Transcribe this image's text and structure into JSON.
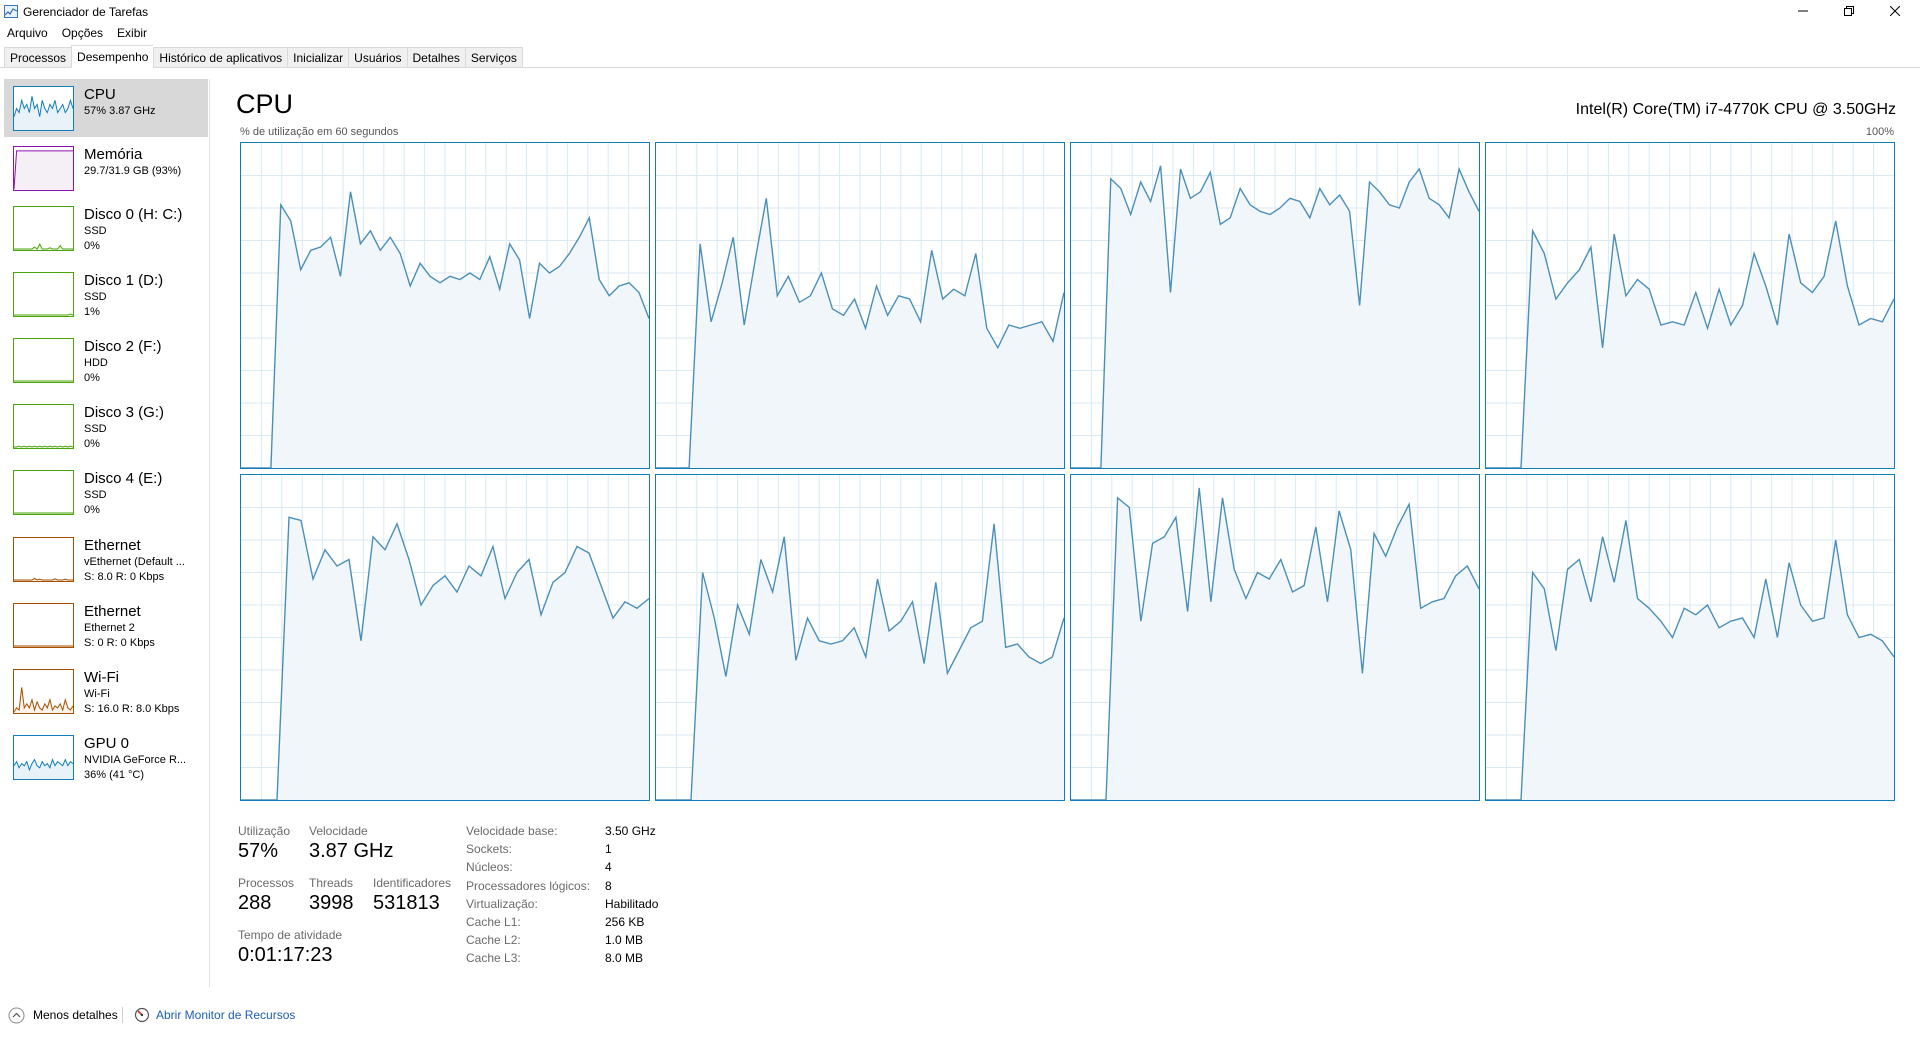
{
  "window": {
    "title": "Gerenciador de Tarefas"
  },
  "menu": [
    "Arquivo",
    "Opções",
    "Exibir"
  ],
  "tabs": [
    {
      "label": "Processos",
      "active": false
    },
    {
      "label": "Desempenho",
      "active": true
    },
    {
      "label": "Histórico de aplicativos",
      "active": false
    },
    {
      "label": "Inicializar",
      "active": false
    },
    {
      "label": "Usuários",
      "active": false
    },
    {
      "label": "Detalhes",
      "active": false
    },
    {
      "label": "Serviços",
      "active": false
    }
  ],
  "sidebar": {
    "items": [
      {
        "name": "CPU",
        "line1": "57%  3.87 GHz",
        "line2": "",
        "color": "#117dbb",
        "fill": "#e9f2f9",
        "selected": true,
        "history": [
          0.3,
          0.5,
          0.4,
          0.7,
          0.5,
          0.6,
          0.4,
          0.8,
          0.5,
          0.6,
          0.3,
          0.7,
          0.5,
          0.4,
          0.6,
          0.5,
          0.7,
          0.4,
          0.5,
          0.6,
          0.4,
          0.5,
          0.7,
          0.5
        ]
      },
      {
        "name": "Memória",
        "line1": "29.7/31.9 GB (93%)",
        "line2": "",
        "color": "#8b12ae",
        "fill": "#f4f0f6",
        "selected": false,
        "history": [
          0.0,
          0.93,
          0.93,
          0.93,
          0.93,
          0.93,
          0.93,
          0.93,
          0.93,
          0.93,
          0.93,
          0.93,
          0.93,
          0.93,
          0.93,
          0.93,
          0.93,
          0.93,
          0.93,
          0.93,
          0.93,
          0.93,
          0.93,
          0.93
        ]
      },
      {
        "name": "Disco 0 (H: C:)",
        "line1": "SSD",
        "line2": "0%",
        "color": "#4da60c",
        "fill": "#eff7ea",
        "selected": false,
        "history": [
          0,
          0,
          0,
          0,
          0,
          0,
          0,
          0,
          0.05,
          0,
          0.12,
          0,
          0,
          0,
          0.03,
          0,
          0,
          0,
          0.08,
          0,
          0,
          0,
          0,
          0
        ]
      },
      {
        "name": "Disco 1 (D:)",
        "line1": "SSD",
        "line2": "1%",
        "color": "#4da60c",
        "fill": "#eff7ea",
        "selected": false,
        "history": [
          0,
          0,
          0,
          0,
          0,
          0,
          0,
          0,
          0,
          0,
          0,
          0,
          0,
          0,
          0,
          0,
          0,
          0,
          0,
          0,
          0,
          0,
          0.02,
          0
        ]
      },
      {
        "name": "Disco 2 (F:)",
        "line1": "HDD",
        "line2": "0%",
        "color": "#4da60c",
        "fill": "#eff7ea",
        "selected": false,
        "history": [
          0,
          0,
          0,
          0,
          0,
          0,
          0,
          0,
          0,
          0,
          0,
          0,
          0,
          0,
          0,
          0,
          0,
          0,
          0,
          0,
          0,
          0,
          0,
          0
        ]
      },
      {
        "name": "Disco 3 (G:)",
        "line1": "SSD",
        "line2": "0%",
        "color": "#4da60c",
        "fill": "#eff7ea",
        "selected": false,
        "history": [
          0,
          0,
          0.02,
          0,
          0.02,
          0,
          0.02,
          0,
          0.02,
          0,
          0.02,
          0,
          0.02,
          0,
          0.02,
          0,
          0.02,
          0,
          0.02,
          0,
          0.02,
          0,
          0.02,
          0
        ]
      },
      {
        "name": "Disco 4 (E:)",
        "line1": "SSD",
        "line2": "0%",
        "color": "#4da60c",
        "fill": "#eff7ea",
        "selected": false,
        "history": [
          0,
          0,
          0,
          0,
          0,
          0,
          0,
          0,
          0,
          0,
          0,
          0,
          0,
          0,
          0,
          0,
          0,
          0,
          0,
          0,
          0,
          0,
          0,
          0
        ]
      },
      {
        "name": "Ethernet",
        "line1": "vEthernet (Default ...",
        "line2": "S: 8.0  R: 0 Kbps",
        "color": "#a74f01",
        "fill": "#fcf3eb",
        "selected": false,
        "history": [
          0,
          0,
          0,
          0,
          0,
          0,
          0,
          0,
          0.04,
          0,
          0.02,
          0,
          0,
          0,
          0,
          0,
          0.03,
          0,
          0,
          0,
          0.02,
          0,
          0,
          0
        ]
      },
      {
        "name": "Ethernet",
        "line1": "Ethernet 2",
        "line2": "S: 0  R: 0 Kbps",
        "color": "#a74f01",
        "fill": "#fcf3eb",
        "selected": false,
        "history": [
          0,
          0,
          0,
          0,
          0,
          0,
          0,
          0,
          0,
          0,
          0,
          0,
          0,
          0,
          0,
          0,
          0,
          0,
          0,
          0,
          0,
          0,
          0,
          0
        ]
      },
      {
        "name": "Wi-Fi",
        "line1": "Wi-Fi",
        "line2": "S: 16.0  R: 8.0 Kbps",
        "color": "#a74f01",
        "fill": "#fcf3eb",
        "selected": false,
        "history": [
          0,
          0.1,
          0.05,
          0.6,
          0.1,
          0.2,
          0.1,
          0.3,
          0.05,
          0.25,
          0.1,
          0.05,
          0.2,
          0.1,
          0.3,
          0.05,
          0.15,
          0.1,
          0.2,
          0.05,
          0.3,
          0.1,
          0.05,
          0.15
        ]
      },
      {
        "name": "GPU 0",
        "line1": "NVIDIA GeForce R...",
        "line2": "36% (41 °C)",
        "color": "#117dbb",
        "fill": "#e9f2f9",
        "selected": false,
        "history": [
          0.3,
          0.4,
          0.25,
          0.35,
          0.3,
          0.4,
          0.2,
          0.35,
          0.45,
          0.3,
          0.25,
          0.4,
          0.3,
          0.35,
          0.25,
          0.45,
          0.3,
          0.4,
          0.35,
          0.3,
          0.45,
          0.3,
          0.4,
          0.35
        ]
      }
    ]
  },
  "main": {
    "title": "CPU",
    "model": "Intel(R) Core(TM) i7-4770K CPU @ 3.50GHz",
    "graph_caption": "% de utilização em 60 segundos",
    "graph_max": "100%",
    "line_color": "#4b8fb8",
    "fill_color": "#f1f6fa",
    "grid_color": "#d9eaf4",
    "cores": [
      [
        0.0,
        0.0,
        0.0,
        0.0,
        0.81,
        0.76,
        0.61,
        0.67,
        0.68,
        0.71,
        0.59,
        0.85,
        0.69,
        0.73,
        0.67,
        0.71,
        0.66,
        0.56,
        0.63,
        0.59,
        0.57,
        0.59,
        0.58,
        0.6,
        0.58,
        0.65,
        0.55,
        0.69,
        0.64,
        0.46,
        0.63,
        0.6,
        0.62,
        0.66,
        0.71,
        0.77,
        0.58,
        0.53,
        0.56,
        0.57,
        0.54,
        0.46
      ],
      [
        0.0,
        0.0,
        0.0,
        0.0,
        0.69,
        0.45,
        0.57,
        0.71,
        0.44,
        0.64,
        0.83,
        0.53,
        0.59,
        0.51,
        0.53,
        0.6,
        0.49,
        0.47,
        0.52,
        0.43,
        0.56,
        0.47,
        0.53,
        0.52,
        0.45,
        0.67,
        0.52,
        0.55,
        0.53,
        0.66,
        0.43,
        0.37,
        0.44,
        0.43,
        0.44,
        0.45,
        0.39,
        0.54
      ],
      [
        0.0,
        0.0,
        0.0,
        0.0,
        0.89,
        0.86,
        0.78,
        0.88,
        0.82,
        0.93,
        0.54,
        0.92,
        0.83,
        0.85,
        0.91,
        0.75,
        0.77,
        0.86,
        0.81,
        0.79,
        0.78,
        0.8,
        0.83,
        0.82,
        0.77,
        0.86,
        0.81,
        0.84,
        0.79,
        0.5,
        0.88,
        0.85,
        0.81,
        0.8,
        0.88,
        0.92,
        0.83,
        0.81,
        0.77,
        0.92,
        0.85,
        0.79
      ],
      [
        0.0,
        0.0,
        0.0,
        0.0,
        0.73,
        0.66,
        0.52,
        0.57,
        0.61,
        0.68,
        0.37,
        0.72,
        0.53,
        0.58,
        0.55,
        0.44,
        0.45,
        0.44,
        0.54,
        0.43,
        0.55,
        0.44,
        0.5,
        0.66,
        0.56,
        0.44,
        0.72,
        0.57,
        0.54,
        0.59,
        0.76,
        0.56,
        0.44,
        0.46,
        0.45,
        0.52
      ],
      [
        0.0,
        0.0,
        0.0,
        0.0,
        0.87,
        0.86,
        0.68,
        0.77,
        0.72,
        0.74,
        0.49,
        0.81,
        0.77,
        0.85,
        0.74,
        0.6,
        0.66,
        0.69,
        0.64,
        0.72,
        0.69,
        0.78,
        0.62,
        0.7,
        0.74,
        0.57,
        0.67,
        0.7,
        0.78,
        0.76,
        0.66,
        0.56,
        0.61,
        0.59,
        0.62
      ],
      [
        0.0,
        0.0,
        0.0,
        0.0,
        0.7,
        0.56,
        0.38,
        0.6,
        0.51,
        0.74,
        0.64,
        0.81,
        0.43,
        0.56,
        0.49,
        0.48,
        0.49,
        0.53,
        0.44,
        0.68,
        0.52,
        0.55,
        0.61,
        0.42,
        0.67,
        0.39,
        0.46,
        0.53,
        0.55,
        0.85,
        0.47,
        0.48,
        0.44,
        0.42,
        0.44,
        0.56
      ],
      [
        0.0,
        0.0,
        0.0,
        0.0,
        0.93,
        0.9,
        0.55,
        0.79,
        0.81,
        0.87,
        0.58,
        0.96,
        0.61,
        0.93,
        0.71,
        0.62,
        0.7,
        0.68,
        0.74,
        0.64,
        0.66,
        0.84,
        0.61,
        0.89,
        0.77,
        0.39,
        0.82,
        0.75,
        0.84,
        0.91,
        0.59,
        0.61,
        0.62,
        0.69,
        0.72,
        0.65
      ],
      [
        0.0,
        0.0,
        0.0,
        0.0,
        0.7,
        0.65,
        0.46,
        0.71,
        0.74,
        0.61,
        0.81,
        0.67,
        0.86,
        0.62,
        0.59,
        0.55,
        0.5,
        0.59,
        0.57,
        0.6,
        0.53,
        0.55,
        0.56,
        0.5,
        0.68,
        0.5,
        0.73,
        0.6,
        0.55,
        0.56,
        0.8,
        0.57,
        0.5,
        0.51,
        0.49,
        0.44
      ]
    ]
  },
  "stats": {
    "utilization": {
      "label": "Utilização",
      "value": "57%"
    },
    "speed": {
      "label": "Velocidade",
      "value": "3.87 GHz"
    },
    "processes": {
      "label": "Processos",
      "value": "288"
    },
    "threads": {
      "label": "Threads",
      "value": "3998"
    },
    "handles": {
      "label": "Identificadores",
      "value": "531813"
    },
    "uptime": {
      "label": "Tempo de atividade",
      "value": "0:01:17:23"
    }
  },
  "specs": [
    {
      "label": "Velocidade base:",
      "value": "3.50 GHz",
      "bold": false
    },
    {
      "label": "Sockets:",
      "value": "1",
      "bold": false
    },
    {
      "label": "Núcleos:",
      "value": "4",
      "bold": false
    },
    {
      "label": "Processadores lógicos:",
      "value": "8",
      "bold": false
    },
    {
      "label": "Virtualização:",
      "value": "Habilitado",
      "bold": false
    },
    {
      "label": "Cache L1:",
      "value": "256 KB",
      "bold": false
    },
    {
      "label": "Cache L2:",
      "value": "1.0 MB",
      "bold": false
    },
    {
      "label": "Cache L3:",
      "value": "8.0 MB",
      "bold": false
    }
  ],
  "footer": {
    "less_details": "Menos detalhes",
    "resource_monitor": "Abrir Monitor de Recursos"
  }
}
